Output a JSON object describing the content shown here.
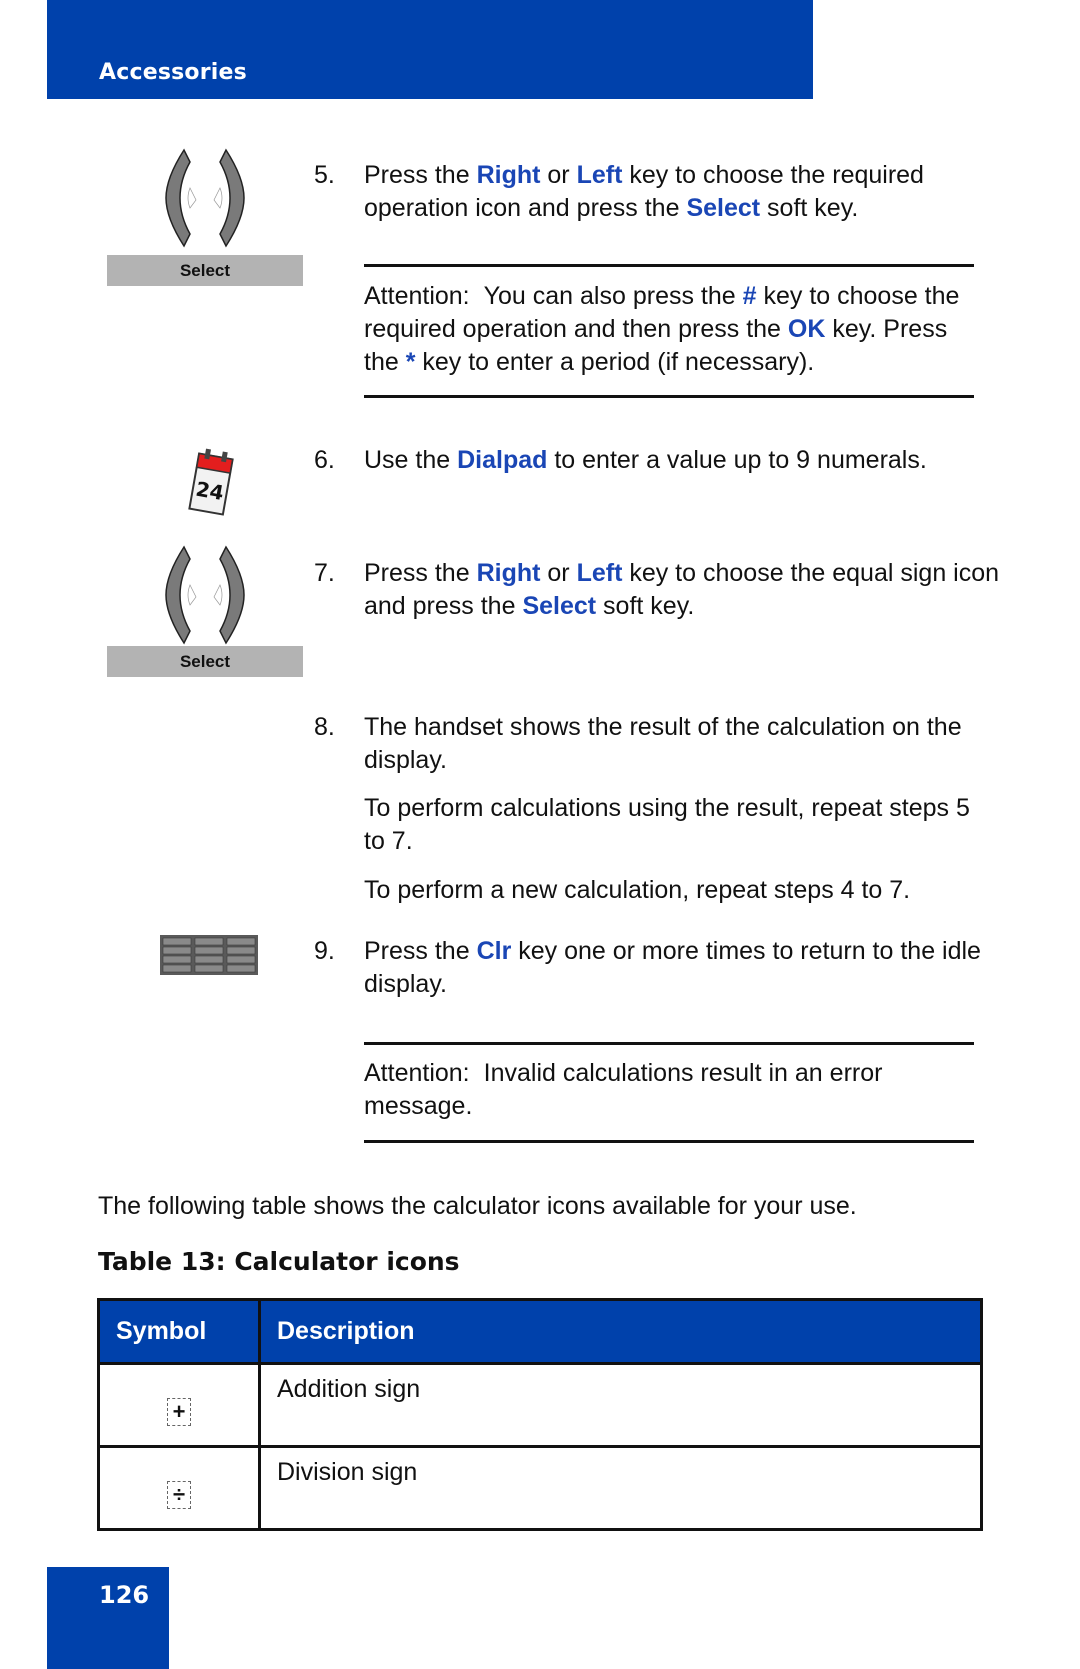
{
  "header": {
    "section_title": "Accessories"
  },
  "side_icons": {
    "softkey_label_1": "Select",
    "softkey_label_2": "Select",
    "calendar_day": "24"
  },
  "steps": {
    "s5": {
      "number": "5.",
      "t1": "Press the ",
      "k1": "Right",
      "t2": " or ",
      "k2": "Left",
      "t3": " key to choose the required operation icon and press the ",
      "k3": "Select",
      "t4": " soft key."
    },
    "attention1": {
      "label": "Attention:",
      "t1": "You can also press the ",
      "k1": "#",
      "t2": " key to choose the required operation and then press the ",
      "k2": "OK",
      "t3": " key. Press the ",
      "k3": "*",
      "t4": " key to enter a period (if necessary)."
    },
    "s6": {
      "number": "6.",
      "t1": "Use the ",
      "k1": "Dialpad",
      "t2": " to enter a value up to 9 numerals."
    },
    "s7": {
      "number": "7.",
      "t1": "Press the ",
      "k1": "Right",
      "t2": " or ",
      "k2": "Left",
      "t3": " key to choose the equal sign icon and press the ",
      "k3": "Select",
      "t4": " soft key."
    },
    "s8": {
      "number": "8.",
      "text": "The handset shows the result of the calculation on the display.",
      "p1": "To perform calculations using the result, repeat steps 5 to 7.",
      "p2": "To perform a new calculation, repeat steps 4 to 7."
    },
    "s9": {
      "number": "9.",
      "t1": "Press the ",
      "k1": "Clr",
      "t2": " key one or more times to return to the idle display."
    },
    "attention2": {
      "label": "Attention:",
      "text": "Invalid calculations result in an error message."
    }
  },
  "intro": "The following table shows the calculator icons available for your use.",
  "table": {
    "caption": "Table 13: Calculator icons",
    "headers": [
      "Symbol",
      "Description"
    ],
    "rows": [
      {
        "symbol": "+",
        "description": "Addition sign"
      },
      {
        "symbol": "÷",
        "description": "Division sign"
      }
    ]
  },
  "footer": {
    "page_number": "126"
  },
  "colors": {
    "brand_blue": "#0041ab",
    "keyword_blue": "#1a46b5",
    "softkey_gray": "#b3b3b3"
  }
}
